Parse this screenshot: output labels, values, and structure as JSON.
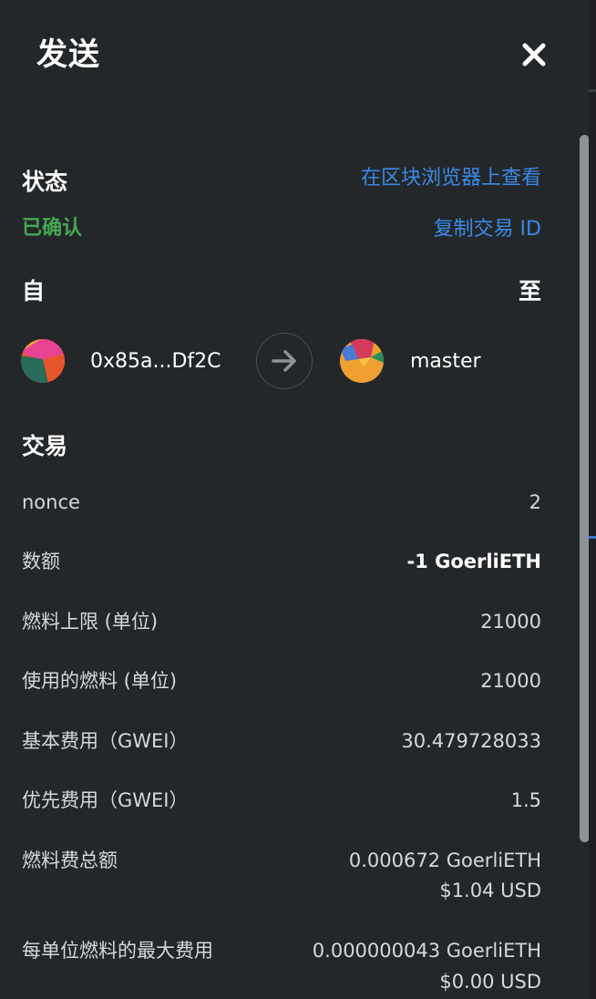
{
  "header": {
    "title": "发送"
  },
  "status": {
    "label": "状态",
    "value": "已确认",
    "value_color": "#45a852",
    "view_on_explorer": "在区块浏览器上查看",
    "copy_tx_id": "复制交易 ID",
    "link_color": "#3a8ae6"
  },
  "from_to": {
    "from_label": "自",
    "to_label": "至",
    "from_address": "0x85a...Df2C",
    "to_name": "master"
  },
  "transaction": {
    "heading": "交易",
    "rows": [
      {
        "label": "nonce",
        "value": "2"
      },
      {
        "label": "数额",
        "value": "-1 GoerliETH"
      },
      {
        "label": "燃料上限 (单位)",
        "value": "21000"
      },
      {
        "label": "使用的燃料 (单位)",
        "value": "21000"
      },
      {
        "label": "基本费用（GWEI）",
        "value": "30.479728033"
      },
      {
        "label": "优先费用（GWEI）",
        "value": "1.5"
      },
      {
        "label": "燃料费总额",
        "value": "0.000672 GoerliETH",
        "value2": "$1.04 USD"
      },
      {
        "label": "每单位燃料的最大费用",
        "value": "0.000000043 GoerliETH",
        "value2": "$0.00 USD"
      }
    ]
  },
  "colors": {
    "background": "#24272a",
    "text": "#ffffff",
    "muted_text": "#d6d9dc"
  }
}
